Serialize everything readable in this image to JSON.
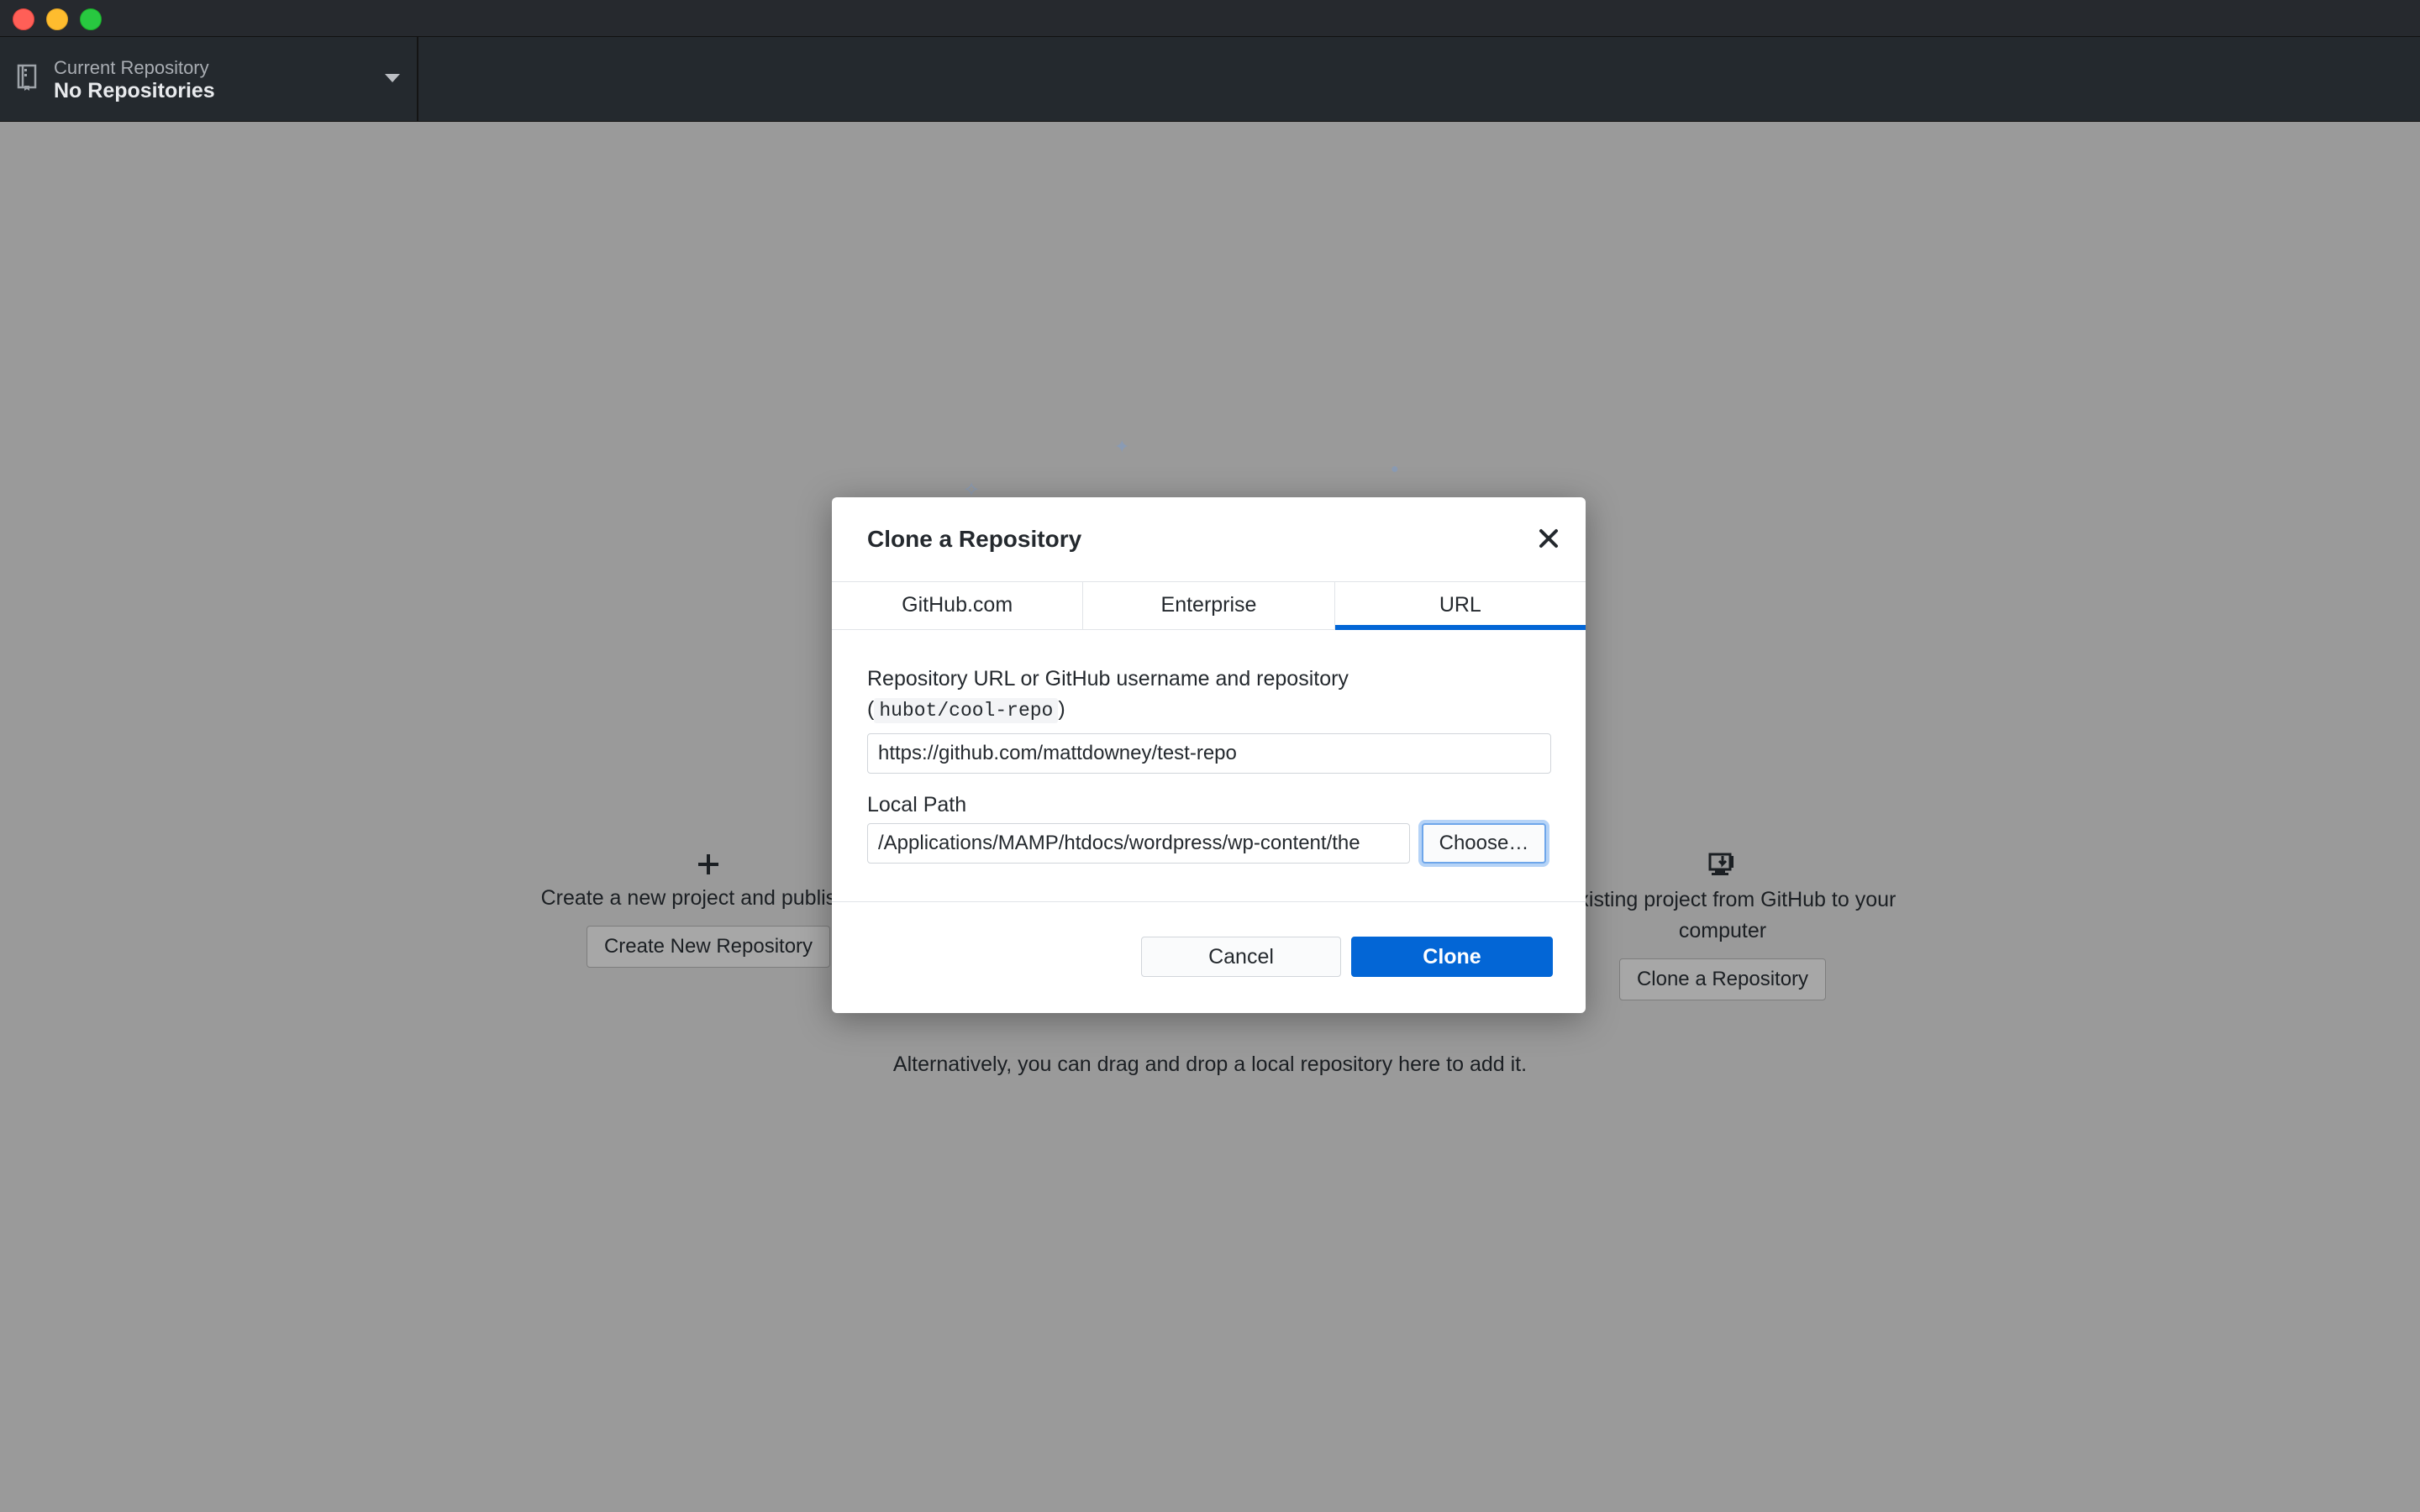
{
  "toolbar": {
    "repository_caption": "Current Repository",
    "repository_value": "No Repositories"
  },
  "welcome": {
    "create": {
      "description": "Create a new project and publish it t",
      "button": "Create New Repository"
    },
    "clone": {
      "description_line1": "n existing project from GitHub to your",
      "description_line2": "computer",
      "button": "Clone a Repository"
    },
    "alternative_text": "Alternatively, you can drag and drop a local repository here to add it."
  },
  "dialog": {
    "title": "Clone a Repository",
    "tabs": [
      {
        "label": "GitHub.com",
        "active": false
      },
      {
        "label": "Enterprise",
        "active": false
      },
      {
        "label": "URL",
        "active": true
      }
    ],
    "url_label": "Repository URL or GitHub username and repository",
    "url_example_open": "(",
    "url_example": "hubot/cool-repo",
    "url_example_close": ")",
    "url_value": "https://github.com/mattdowney/test-repo",
    "local_path_label": "Local Path",
    "local_path_value": "/Applications/MAMP/htdocs/wordpress/wp-content/the",
    "choose_button": "Choose…",
    "cancel_button": "Cancel",
    "clone_button": "Clone"
  },
  "colors": {
    "accent": "#0366d6",
    "overlay": "#9a9a9a",
    "toolbar": "#24292e"
  }
}
